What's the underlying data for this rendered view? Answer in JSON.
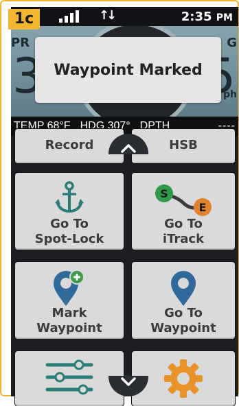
{
  "step_badge": "1c",
  "status_bar": {
    "time": "2:35",
    "ampm": "PM"
  },
  "gauges": {
    "left_label": "PR",
    "left_value": "3",
    "right_label": "G",
    "right_value": "5",
    "right_unit": "ph"
  },
  "toast": {
    "message": "Waypoint Marked"
  },
  "data_bar": {
    "temp": "TEMP 68°F",
    "hdg": "HDG 307°",
    "dpth": "DPTH",
    "dpth_value": "----"
  },
  "tiles": {
    "record": "Record",
    "hsb": "HSB",
    "spot_lock_line1": "Go To",
    "spot_lock_line2": "Spot-Lock",
    "itrack_line1": "Go To",
    "itrack_line2": "iTrack",
    "itrack_start": "S",
    "itrack_end": "E",
    "mark_line1": "Mark",
    "mark_line2": "Waypoint",
    "goto_wp_line1": "Go To",
    "goto_wp_line2": "Waypoint"
  },
  "colors": {
    "accent_badge": "#f2b630",
    "icon_blue": "#2f6a9a",
    "icon_teal": "#2a7c78",
    "itrack_green": "#2f9a4a",
    "itrack_orange": "#e0822b",
    "gear_orange": "#e8922a",
    "plus_green": "#3d9a45"
  }
}
